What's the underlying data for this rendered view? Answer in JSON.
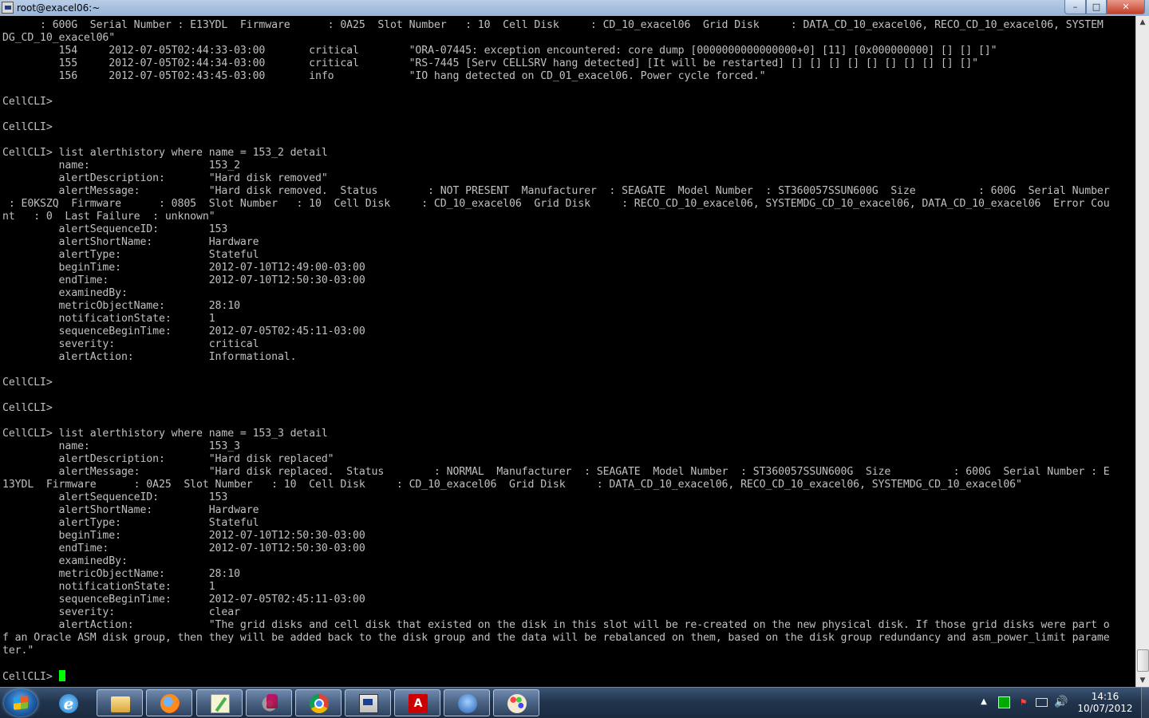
{
  "window": {
    "title": "root@exacel06:~",
    "buttons": {
      "minimize": "–",
      "maximize": "□",
      "close": "✕"
    }
  },
  "terminal": {
    "lines": [
      "      : 600G  Serial Number : E13YDL  Firmware      : 0A25  Slot Number   : 10  Cell Disk     : CD_10_exacel06  Grid Disk     : DATA_CD_10_exacel06, RECO_CD_10_exacel06, SYSTEM",
      "DG_CD_10_exacel06\"",
      "         154     2012-07-05T02:44:33-03:00       critical        \"ORA-07445: exception encountered: core dump [0000000000000000+0] [11] [0x000000000] [] [] []\"",
      "         155     2012-07-05T02:44:34-03:00       critical        \"RS-7445 [Serv CELLSRV hang detected] [It will be restarted] [] [] [] [] [] [] [] [] [] []\"",
      "         156     2012-07-05T02:43:45-03:00       info            \"IO hang detected on CD_01_exacel06. Power cycle forced.\"",
      "",
      "CellCLI>",
      "",
      "CellCLI>",
      "",
      "CellCLI> list alerthistory where name = 153_2 detail",
      "         name:                   153_2",
      "         alertDescription:       \"Hard disk removed\"",
      "         alertMessage:           \"Hard disk removed.  Status        : NOT PRESENT  Manufacturer  : SEAGATE  Model Number  : ST360057SSUN600G  Size          : 600G  Serial Number",
      " : E0KSZQ  Firmware      : 0805  Slot Number   : 10  Cell Disk     : CD_10_exacel06  Grid Disk     : RECO_CD_10_exacel06, SYSTEMDG_CD_10_exacel06, DATA_CD_10_exacel06  Error Cou",
      "nt   : 0  Last Failure  : unknown\"",
      "         alertSequenceID:        153",
      "         alertShortName:         Hardware",
      "         alertType:              Stateful",
      "         beginTime:              2012-07-10T12:49:00-03:00",
      "         endTime:                2012-07-10T12:50:30-03:00",
      "         examinedBy:",
      "         metricObjectName:       28:10",
      "         notificationState:      1",
      "         sequenceBeginTime:      2012-07-05T02:45:11-03:00",
      "         severity:               critical",
      "         alertAction:            Informational.",
      "",
      "CellCLI>",
      "",
      "CellCLI>",
      "",
      "CellCLI> list alerthistory where name = 153_3 detail",
      "         name:                   153_3",
      "         alertDescription:       \"Hard disk replaced\"",
      "         alertMessage:           \"Hard disk replaced.  Status        : NORMAL  Manufacturer  : SEAGATE  Model Number  : ST360057SSUN600G  Size          : 600G  Serial Number : E",
      "13YDL  Firmware      : 0A25  Slot Number   : 10  Cell Disk     : CD_10_exacel06  Grid Disk     : DATA_CD_10_exacel06, RECO_CD_10_exacel06, SYSTEMDG_CD_10_exacel06\"",
      "         alertSequenceID:        153",
      "         alertShortName:         Hardware",
      "         alertType:              Stateful",
      "         beginTime:              2012-07-10T12:50:30-03:00",
      "         endTime:                2012-07-10T12:50:30-03:00",
      "         examinedBy:",
      "         metricObjectName:       28:10",
      "         notificationState:      1",
      "         sequenceBeginTime:      2012-07-05T02:45:11-03:00",
      "         severity:               clear",
      "         alertAction:            \"The grid disks and cell disk that existed on the disk in this slot will be re-created on the new physical disk. If those grid disks were part o",
      "f an Oracle ASM disk group, then they will be added back to the disk group and the data will be rebalanced on them, based on the disk group redundancy and asm_power_limit parame",
      "ter.\"",
      ""
    ],
    "prompt": "CellCLI> ",
    "cursor_color": "#00ff00",
    "text_color": "#c0c0c0",
    "background": "#000000"
  },
  "taskbar": {
    "start_icon": "windows-logo-icon",
    "apps": [
      {
        "name": "internet-explorer-icon",
        "glyph": "e"
      },
      {
        "name": "folder-icon",
        "glyph": ""
      },
      {
        "name": "firefox-icon",
        "glyph": ""
      },
      {
        "name": "notepad-icon",
        "glyph": ""
      },
      {
        "name": "settings-db-icon",
        "glyph": ""
      },
      {
        "name": "chrome-icon",
        "glyph": ""
      },
      {
        "name": "putty-icon",
        "glyph": ""
      },
      {
        "name": "pdf-reader-icon",
        "glyph": "A"
      },
      {
        "name": "thunderbird-icon",
        "glyph": ""
      },
      {
        "name": "paint-icon",
        "glyph": ""
      }
    ],
    "tray": {
      "arrow": "▲",
      "speaker": "🔊"
    },
    "clock": {
      "time": "14:16",
      "date": "10/07/2012"
    }
  }
}
